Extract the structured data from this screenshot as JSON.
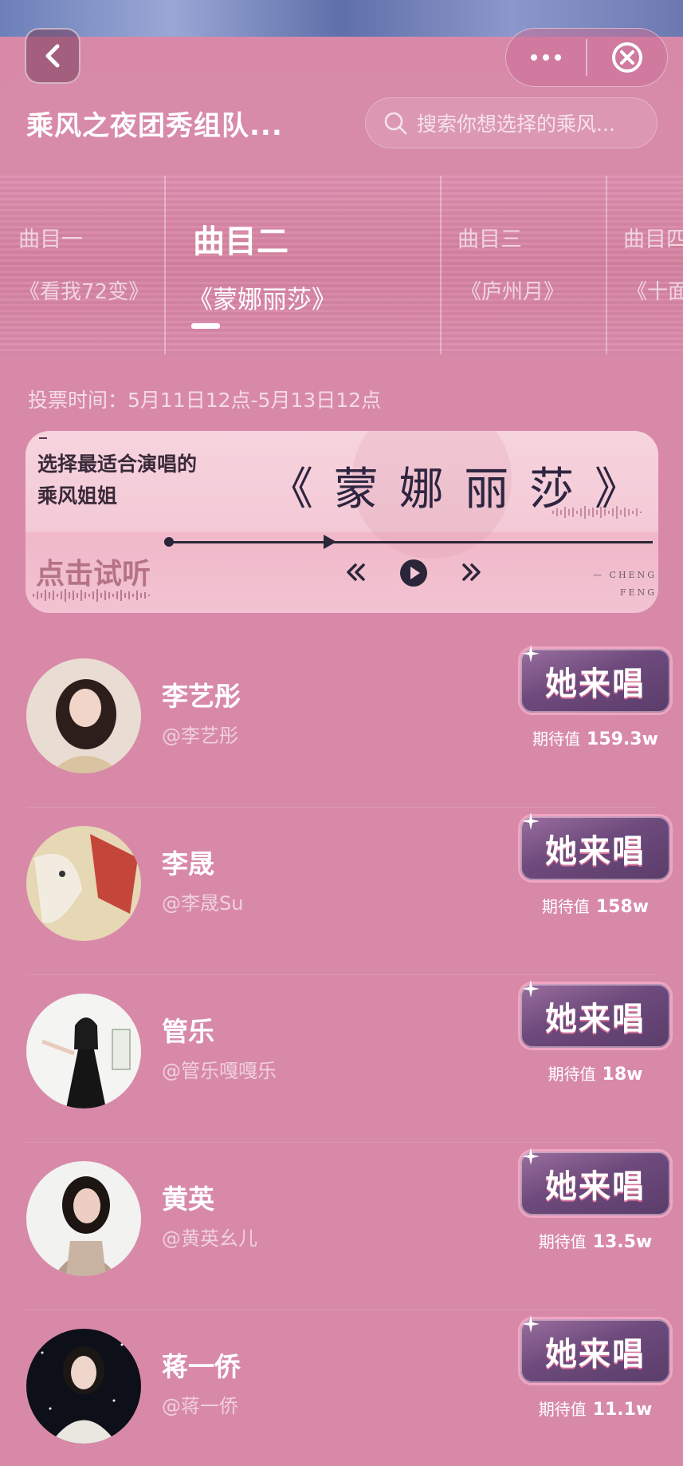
{
  "nav": {
    "back_icon": "chevron-left-icon",
    "more_icon": "more-dots-icon",
    "close_icon": "close-circle-icon"
  },
  "header": {
    "title": "乘风之夜团秀组队...",
    "search_placeholder": "搜索你想选择的乘风..."
  },
  "tabs": [
    {
      "num": "曲目一",
      "song": "《看我72变》",
      "active": false
    },
    {
      "num": "曲目二",
      "song": "《蒙娜丽莎》",
      "active": true
    },
    {
      "num": "曲目三",
      "song": "《庐州月》",
      "active": false
    },
    {
      "num": "曲目四",
      "song": "《十面",
      "active": false
    }
  ],
  "vote_time": "投票时间：5月11日12点-5月13日12点",
  "audio_card": {
    "prompt_line1": "选择最适合演唱的",
    "prompt_line2": "乘风姐姐",
    "song_title": "《 蒙 娜 丽 莎 》",
    "listen_label": "点击试听",
    "brand_line1": "— CHENG",
    "brand_line2": "FENG",
    "progress": 0.32
  },
  "vote_button_label": "她来唱",
  "expect_label": "期待值",
  "contestants": [
    {
      "name": "李艺彤",
      "handle": "@李艺彤",
      "expect": "159.3w"
    },
    {
      "name": "李晟",
      "handle": "@李晟Su",
      "expect": "158w"
    },
    {
      "name": "管乐",
      "handle": "@管乐嘎嘎乐",
      "expect": "18w"
    },
    {
      "name": "黄英",
      "handle": "@黄英幺儿",
      "expect": "13.5w"
    },
    {
      "name": "蒋一侨",
      "handle": "@蒋一侨",
      "expect": "11.1w"
    }
  ],
  "colors": {
    "background": "#d889a8",
    "button_purple": "#6d4a7c",
    "button_border": "#f0a6c0",
    "card_pink": "#f6d4de"
  }
}
